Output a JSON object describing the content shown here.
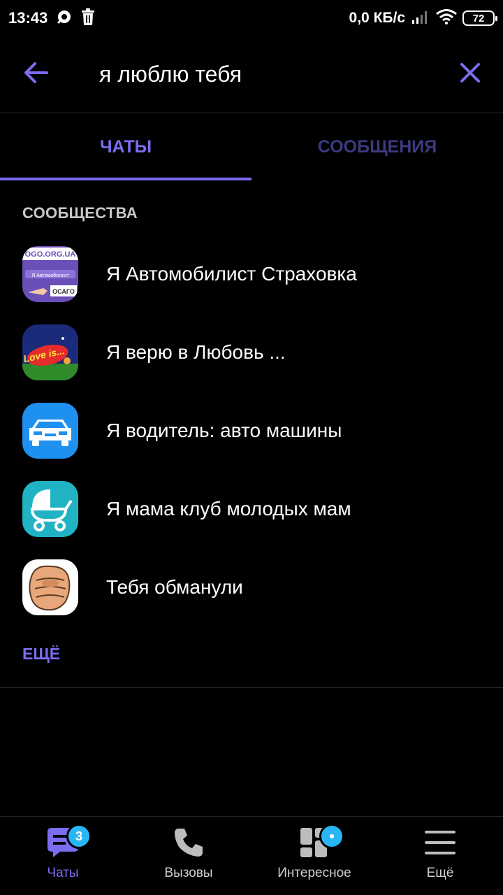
{
  "status_bar": {
    "time": "13:43",
    "network_speed": "0,0 КБ/с",
    "battery": "72",
    "icons": [
      "viber-notification-icon",
      "trash-icon",
      "signal-icon",
      "wifi-icon",
      "battery-icon"
    ]
  },
  "search": {
    "query": "я люблю тебя",
    "back_icon": "arrow-left-icon",
    "clear_icon": "close-icon"
  },
  "tabs": [
    {
      "label": "ЧАТЫ",
      "active": true
    },
    {
      "label": "СООБЩЕНИЯ",
      "active": false
    }
  ],
  "section": {
    "title": "СООБЩЕСТВА",
    "items": [
      {
        "name": "Я Автомобилист Страховка",
        "avatar": "insurance-avatar",
        "avatar_text_top": "OGO.ORG.UA",
        "avatar_text_mid": "Я Автомобилист",
        "avatar_text_btm": "ОСАГО"
      },
      {
        "name": "Я верю в Любовь ...",
        "avatar": "love-is-avatar",
        "avatar_text": "Love is..."
      },
      {
        "name": "Я водитель: авто машины",
        "avatar": "car-avatar"
      },
      {
        "name": "Я мама клуб молодых мам",
        "avatar": "stroller-avatar"
      },
      {
        "name": "Тебя обманули",
        "avatar": "fist-avatar"
      }
    ],
    "more": "ЕЩЁ"
  },
  "bottom_nav": [
    {
      "label": "Чаты",
      "icon": "chat-bubble-icon",
      "active": true,
      "badge": "3"
    },
    {
      "label": "Вызовы",
      "icon": "phone-icon",
      "active": false
    },
    {
      "label": "Интересное",
      "icon": "explore-icon",
      "active": false,
      "badge_dot": true
    },
    {
      "label": "Ещё",
      "icon": "menu-icon",
      "active": false
    }
  ],
  "colors": {
    "accent": "#7b6df0",
    "tab_inactive": "#3c3a80",
    "badge": "#2ab6f5",
    "background": "#000000"
  }
}
